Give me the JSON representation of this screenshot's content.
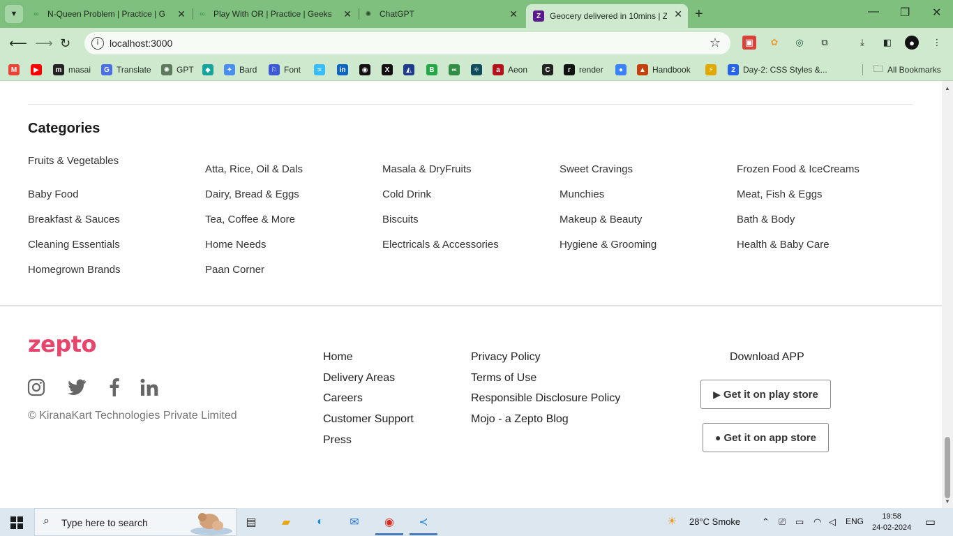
{
  "browser": {
    "tabs": [
      {
        "title": "N-Queen Problem | Practice | G",
        "favicon": "gfg-icon"
      },
      {
        "title": "Play With OR | Practice | Geeksf",
        "favicon": "gfg-icon"
      },
      {
        "title": "ChatGPT",
        "favicon": "chatgpt-icon"
      },
      {
        "title": "Geocery delivered in 10mins | Z",
        "favicon": "zepto-icon"
      }
    ],
    "url": "localhost:3000",
    "bookmarks": [
      {
        "label": "",
        "icon": "gmail-icon",
        "color": "#ea4335",
        "glyph": "M"
      },
      {
        "label": "",
        "icon": "youtube-icon",
        "color": "#ff0000",
        "glyph": "▶"
      },
      {
        "label": "masai",
        "icon": "masai-icon",
        "color": "#222222",
        "glyph": "m"
      },
      {
        "label": "Translate",
        "icon": "translate-icon",
        "color": "#4a6fe3",
        "glyph": "G"
      },
      {
        "label": "GPT",
        "icon": "gpt-icon",
        "color": "#5b7b5b",
        "glyph": "✺"
      },
      {
        "label": "",
        "icon": "diamond-icon",
        "color": "#15a39a",
        "glyph": "◆"
      },
      {
        "label": "Bard",
        "icon": "bard-icon",
        "color": "#4a8ff0",
        "glyph": "✦"
      },
      {
        "label": "Font",
        "icon": "font-icon",
        "color": "#3d5ad6",
        "glyph": "⚐"
      },
      {
        "label": "",
        "icon": "tailwind-icon",
        "color": "#38bdf8",
        "glyph": "≈"
      },
      {
        "label": "",
        "icon": "linkedin-icon",
        "color": "#0a66c2",
        "glyph": "in"
      },
      {
        "label": "",
        "icon": "github-icon",
        "color": "#111111",
        "glyph": "◉"
      },
      {
        "label": "",
        "icon": "x-icon",
        "color": "#111111",
        "glyph": "X"
      },
      {
        "label": "",
        "icon": "kaggle-icon",
        "color": "#1e3a8a",
        "glyph": "◭"
      },
      {
        "label": "",
        "icon": "bookmark-green-icon",
        "color": "#22a745",
        "glyph": "B"
      },
      {
        "label": "",
        "icon": "gfg-icon",
        "color": "#2f8d46",
        "glyph": "∞"
      },
      {
        "label": "",
        "icon": "react-icon",
        "color": "#0f4c5c",
        "glyph": "⚛"
      },
      {
        "label": "Aeon",
        "icon": "aeon-icon",
        "color": "#b5121b",
        "glyph": "a"
      },
      {
        "label": "",
        "icon": "chess-icon",
        "color": "#222222",
        "glyph": "C"
      },
      {
        "label": "render",
        "icon": "render-icon",
        "color": "#111111",
        "glyph": "r"
      },
      {
        "label": "",
        "icon": "circle-blue-icon",
        "color": "#3b82f6",
        "glyph": "●"
      },
      {
        "label": "Handbook",
        "icon": "handbook-icon",
        "color": "#c2410c",
        "glyph": "▲"
      },
      {
        "label": "",
        "icon": "lightning-icon",
        "color": "#e0a800",
        "glyph": "⚡"
      },
      {
        "label": "Day-2: CSS Styles &...",
        "icon": "doc-icon",
        "color": "#2563eb",
        "glyph": "2"
      }
    ],
    "all_bookmarks": "All Bookmarks"
  },
  "page": {
    "categories_heading": "Categories",
    "categories": [
      [
        "Fruits & Vegetables",
        "Atta, Rice, Oil & Dals",
        "Masala & DryFruits",
        "Sweet Cravings",
        "Frozen Food & IceCreams"
      ],
      [
        "Baby Food",
        "Dairy, Bread & Eggs",
        "Cold Drink",
        "Munchies",
        "Meat, Fish & Eggs"
      ],
      [
        "Breakfast & Sauces",
        "Tea, Coffee & More",
        "Biscuits",
        "Makeup & Beauty",
        "Bath & Body"
      ],
      [
        "Cleaning Essentials",
        "Home Needs",
        "Electricals & Accessories",
        "Hygiene & Grooming",
        "Health & Baby Care"
      ],
      [
        "Homegrown Brands",
        "Paan Corner"
      ]
    ],
    "footer": {
      "logo": "zepto",
      "social": [
        "instagram-icon",
        "twitter-icon",
        "facebook-icon",
        "linkedin-icon"
      ],
      "copyright": "© KiranaKart Technologies Private Limited",
      "links_col1": [
        "Home",
        "Delivery Areas",
        "Careers",
        "Customer Support",
        "Press"
      ],
      "links_col2": [
        "Privacy Policy",
        "Terms of Use",
        "Responsible Disclosure Policy",
        "Mojo - a Zepto Blog"
      ],
      "download_title": "Download APP",
      "play_store": "Get it on play store",
      "app_store": "Get it on app store"
    }
  },
  "taskbar": {
    "search_placeholder": "Type here to search",
    "weather": "28°C  Smoke",
    "lang": "ENG",
    "time": "19:58",
    "date": "24-02-2024"
  }
}
